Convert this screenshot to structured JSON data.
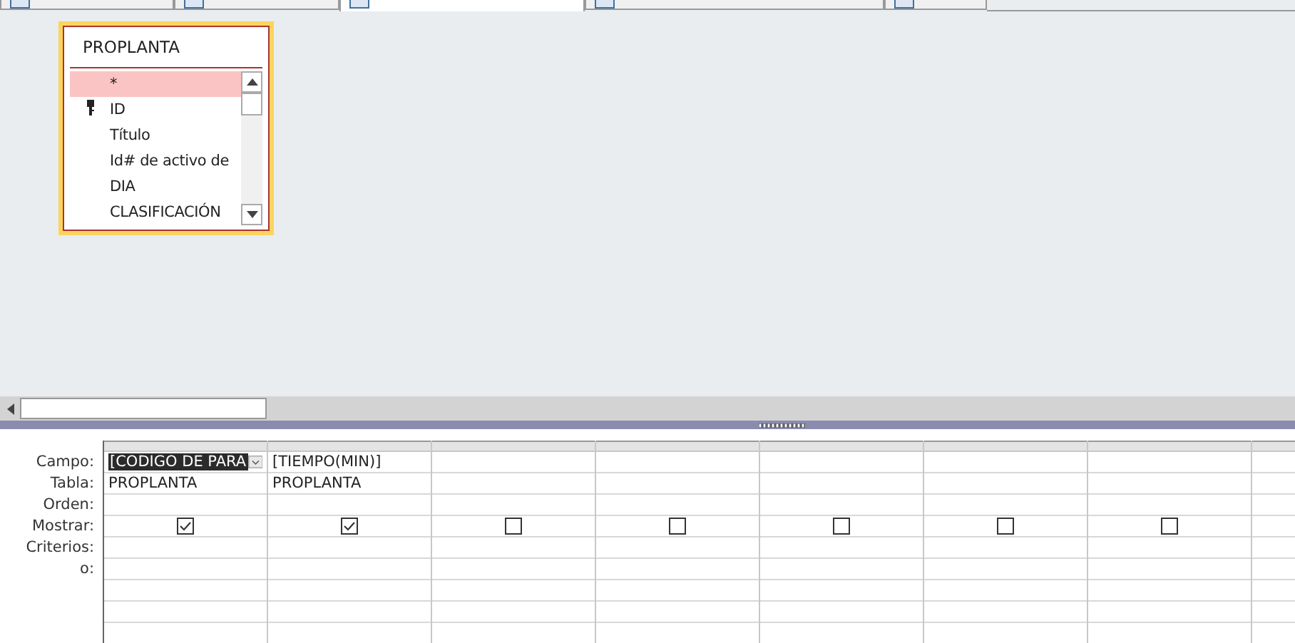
{
  "tabs": [
    {
      "selected": false
    },
    {
      "selected": false
    },
    {
      "selected": true
    },
    {
      "selected": false
    },
    {
      "selected": false
    }
  ],
  "table_box": {
    "title": "PROPLANTA",
    "fields": [
      {
        "name": "*",
        "key": false,
        "selected": true
      },
      {
        "name": "ID",
        "key": true,
        "selected": false
      },
      {
        "name": "Título",
        "key": false,
        "selected": false
      },
      {
        "name": "Id# de activo de",
        "key": false,
        "selected": false
      },
      {
        "name": "DIA",
        "key": false,
        "selected": false
      },
      {
        "name": "CLASIFICACIÓN",
        "key": false,
        "selected": false
      }
    ]
  },
  "grid": {
    "row_labels": [
      "Campo:",
      "Tabla:",
      "Orden:",
      "Mostrar:",
      "Criterios:",
      "o:"
    ],
    "columns": [
      {
        "campo": "[CODIGO DE PARA",
        "tabla": "PROPLANTA",
        "mostrar": true,
        "selected": true
      },
      {
        "campo": "[TIEMPO(MIN)]",
        "tabla": "PROPLANTA",
        "mostrar": true,
        "selected": false
      },
      {
        "mostrar": false,
        "selected": false
      },
      {
        "mostrar": false,
        "selected": false
      },
      {
        "mostrar": false,
        "selected": false
      },
      {
        "mostrar": false,
        "selected": false
      },
      {
        "mostrar": false,
        "selected": false
      }
    ]
  }
}
